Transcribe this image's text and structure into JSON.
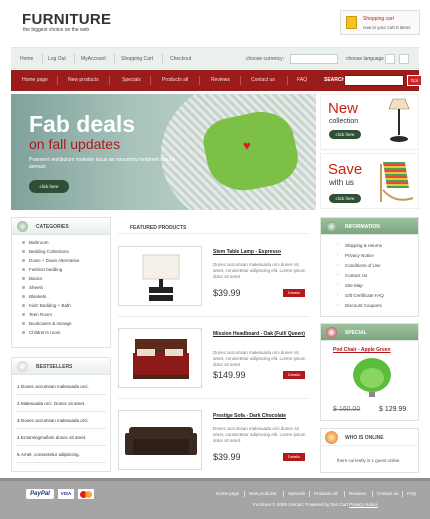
{
  "brand": {
    "logo": "FURNITURE",
    "tagline": "the biggest choice on the web"
  },
  "cart": {
    "title": "Shopping cart",
    "info": "now in your cart 0 items"
  },
  "topnav": {
    "items": [
      "Home",
      "Log Out",
      "MyAccount",
      "Shopping Cart",
      "Checkout"
    ],
    "currency_label": "choose currency:",
    "language_label": "choose language"
  },
  "mainnav": {
    "items": [
      "Home page",
      "New products",
      "Specials",
      "Products all",
      "Reviews",
      "Contact us",
      "FAQ"
    ],
    "search_label": "SEARCH",
    "search_button": "Go!"
  },
  "hero": {
    "title": "Fab deals",
    "subtitle": "on fall updates",
    "text": "Praesent vestibulum molestie lacus an nonummy hendrerit mauris aenean",
    "button": "click here"
  },
  "banner_new": {
    "big": "New",
    "small": "collection",
    "button": "click here"
  },
  "banner_save": {
    "big": "Save",
    "small": "with us",
    "button": "click here"
  },
  "categories": {
    "title": "CATEGORIES",
    "items": [
      "Bathroom",
      "Bedding Collections",
      "Down + Down Alternative",
      "Fashion bedding",
      "Basics",
      "Sheets",
      "Blankets",
      "Kids' Bedding + Bath",
      "Teen Room",
      "Bookcases & storage",
      "Children's room"
    ]
  },
  "bestsellers": {
    "title": "BESTSELLERS",
    "items": [
      "Donec accumsan malesuada orci.",
      "Malesuada orci. Donec sit amet.",
      "Donec accumsan malesuada orci.",
      "Erosmingmullam donec sit amet.",
      "Amet, consectetur adipiscing."
    ]
  },
  "featured": {
    "title": "FEATURED PRODUCTS",
    "products": [
      {
        "name": "Stem Table Lamp - Espresso",
        "desc": "Donec accumsan malesuada orci donec sit amet, consectetur adipiscing elit. Lorem ipsum dolor sit amet.",
        "price": "$39.99",
        "button": "Details"
      },
      {
        "name": "Mission Headboard - Oak (Full/ Queen)",
        "desc": "Donec accumsan malesuada orci donec sit amet, consectetur adipiscing elit. Lorem ipsum dolor sit amet.",
        "price": "$149.99",
        "button": "Details"
      },
      {
        "name": "Prestige Sofa - Dark Chocolate",
        "desc": "Donec accumsan malesuada orci donec sit amet, consectetur adipiscing elit. Lorem ipsum dolor sit amet.",
        "price": "$39.99",
        "button": "Details"
      }
    ]
  },
  "information": {
    "title": "INFORMATION",
    "items": [
      "Shipping & returns",
      "Privacy Notice",
      "Conditions of Use",
      "Contact Us",
      "Site Map",
      "Gift Certificate FAQ",
      "Discount Coupons"
    ]
  },
  "special": {
    "title": "SPECIAL",
    "product": "Pod Chair - Apple Green",
    "old_price": "$ 160.00",
    "new_price": "$ 129.99"
  },
  "online": {
    "title": "WHO IS ONLINE",
    "text": "there currently is 1 guest online"
  },
  "footer": {
    "nav": [
      "Home page",
      "New products",
      "Specials",
      "Products all",
      "Reviews",
      "Contact us",
      "FAQ"
    ],
    "copyright_prefix": "Furniture",
    "copyright": "© 2009 zencart. Powered by Zen Cart",
    "privacy": "Privacy Notice",
    "payment": [
      "PayPal",
      "VISA"
    ]
  },
  "colors": {
    "accent_red": "#9c1c1c",
    "green": "#7cc046"
  }
}
